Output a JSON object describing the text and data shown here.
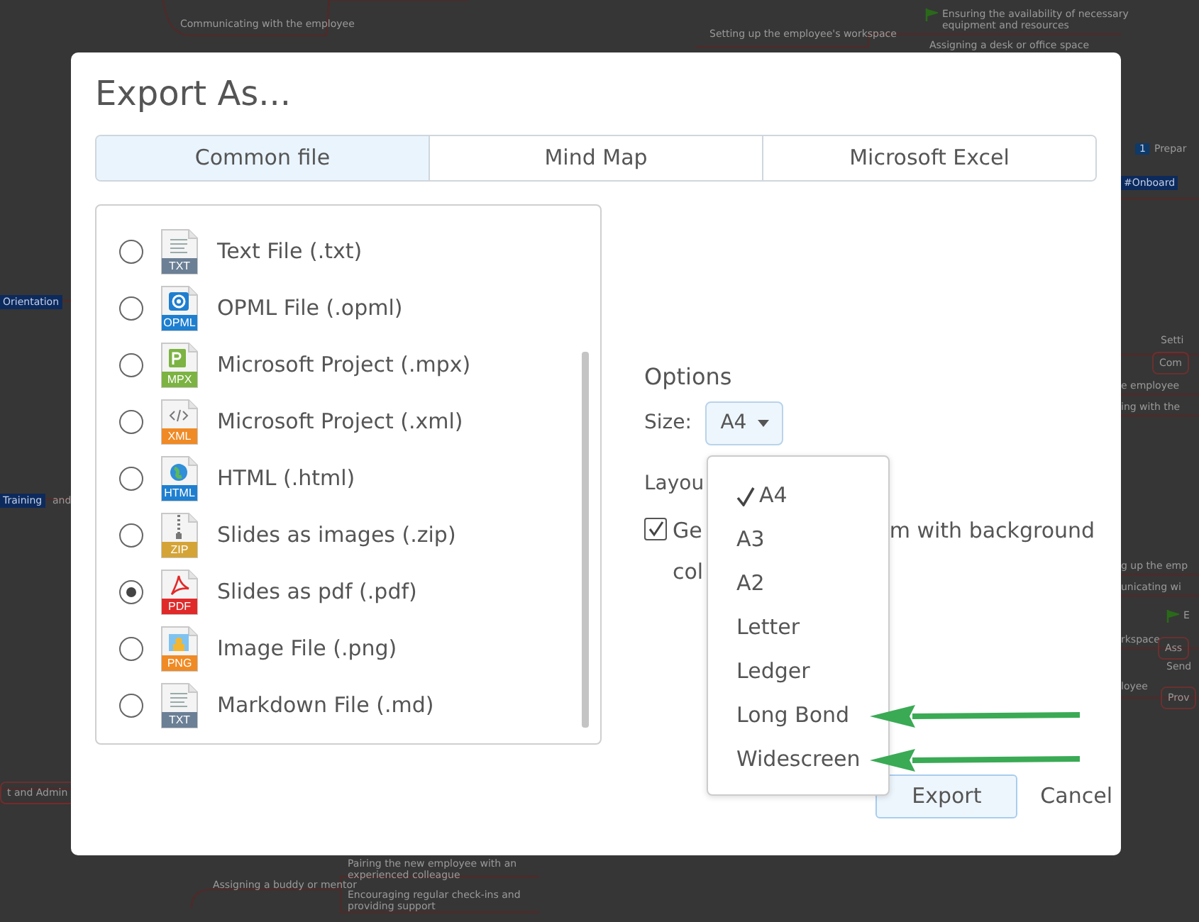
{
  "background_map": {
    "nodes": [
      {
        "text": "Communicating with the employee",
        "kind": "plain"
      },
      {
        "text": "Setting up the employee's workspace",
        "kind": "plain"
      },
      {
        "text": "Ensuring the availability of necessary equipment and resources",
        "kind": "plain",
        "flag": true
      },
      {
        "text": "Assigning a desk or office space",
        "kind": "plain"
      },
      {
        "text": "Pairing the new employee with an experienced colleague",
        "kind": "plain"
      },
      {
        "text": "Assigning a buddy or mentor",
        "kind": "plain"
      },
      {
        "text": "Encouraging regular check-ins and providing support",
        "kind": "plain"
      },
      {
        "text": "Orientation",
        "kind": "tag"
      },
      {
        "text": "Training",
        "kind": "tag"
      },
      {
        "text": "and",
        "kind": "plain"
      },
      {
        "text": "t and Admin",
        "kind": "boxed"
      },
      {
        "text": "Prepar",
        "kind": "numbered",
        "number": "1"
      },
      {
        "text": "#Onboard",
        "kind": "tag"
      },
      {
        "text": "Setti",
        "kind": "plain"
      },
      {
        "text": "Com",
        "kind": "boxed"
      },
      {
        "text": "e employee",
        "kind": "plain"
      },
      {
        "text": "ing with the",
        "kind": "plain"
      },
      {
        "text": "g up the emp",
        "kind": "plain"
      },
      {
        "text": "unicating wi",
        "kind": "plain"
      },
      {
        "text": "E",
        "kind": "plain",
        "flag": true
      },
      {
        "text": "rkspace",
        "kind": "plain"
      },
      {
        "text": "Ass",
        "kind": "boxed"
      },
      {
        "text": "Send",
        "kind": "plain"
      },
      {
        "text": "loyee",
        "kind": "plain"
      },
      {
        "text": "Prov",
        "kind": "boxed"
      }
    ]
  },
  "dialog": {
    "title": "Export As...",
    "tabs": [
      {
        "label": "Common file",
        "selected": true
      },
      {
        "label": "Mind Map",
        "selected": false
      },
      {
        "label": "Microsoft Excel",
        "selected": false
      }
    ],
    "formats": [
      {
        "label": "Text File (.txt)",
        "badge": "TXT",
        "kind": "text",
        "color": "#6b7f95",
        "selected": false
      },
      {
        "label": "OPML File (.opml)",
        "badge": "OPML",
        "kind": "opml",
        "color": "#1e7fd0",
        "selected": false
      },
      {
        "label": "Microsoft Project (.mpx)",
        "badge": "MPX",
        "kind": "project",
        "color": "#7cb342",
        "selected": false
      },
      {
        "label": "Microsoft Project (.xml)",
        "badge": "XML",
        "kind": "xml",
        "color": "#f08a24",
        "selected": false
      },
      {
        "label": "HTML (.html)",
        "badge": "HTML",
        "kind": "html",
        "color": "#1e7fd0",
        "selected": false
      },
      {
        "label": "Slides as images (.zip)",
        "badge": "ZIP",
        "kind": "zip",
        "color": "#d4a437",
        "selected": false
      },
      {
        "label": "Slides as pdf (.pdf)",
        "badge": "PDF",
        "kind": "pdf",
        "color": "#e02a2a",
        "selected": true
      },
      {
        "label": "Image File (.png)",
        "badge": "PNG",
        "kind": "image",
        "color": "#f08a24",
        "selected": false
      },
      {
        "label": "Markdown File (.md)",
        "badge": "TXT",
        "kind": "text",
        "color": "#6b7f95",
        "selected": false
      }
    ],
    "options": {
      "heading": "Options",
      "size_label": "Size:",
      "size_value": "A4",
      "layout_label": "Layou",
      "checkbox": {
        "checked": true,
        "parts": [
          "Ge",
          "m with background",
          "col"
        ]
      }
    },
    "size_menu": [
      {
        "label": "A4",
        "selected": true,
        "arrow": false
      },
      {
        "label": "A3",
        "selected": false,
        "arrow": false
      },
      {
        "label": "A2",
        "selected": false,
        "arrow": false
      },
      {
        "label": "Letter",
        "selected": false,
        "arrow": false
      },
      {
        "label": "Ledger",
        "selected": false,
        "arrow": false
      },
      {
        "label": "Long Bond",
        "selected": false,
        "arrow": true
      },
      {
        "label": "Widescreen",
        "selected": false,
        "arrow": true
      }
    ],
    "buttons": [
      {
        "label": "Export",
        "kind": "primary"
      },
      {
        "label": "Cancel",
        "kind": "link"
      }
    ]
  }
}
